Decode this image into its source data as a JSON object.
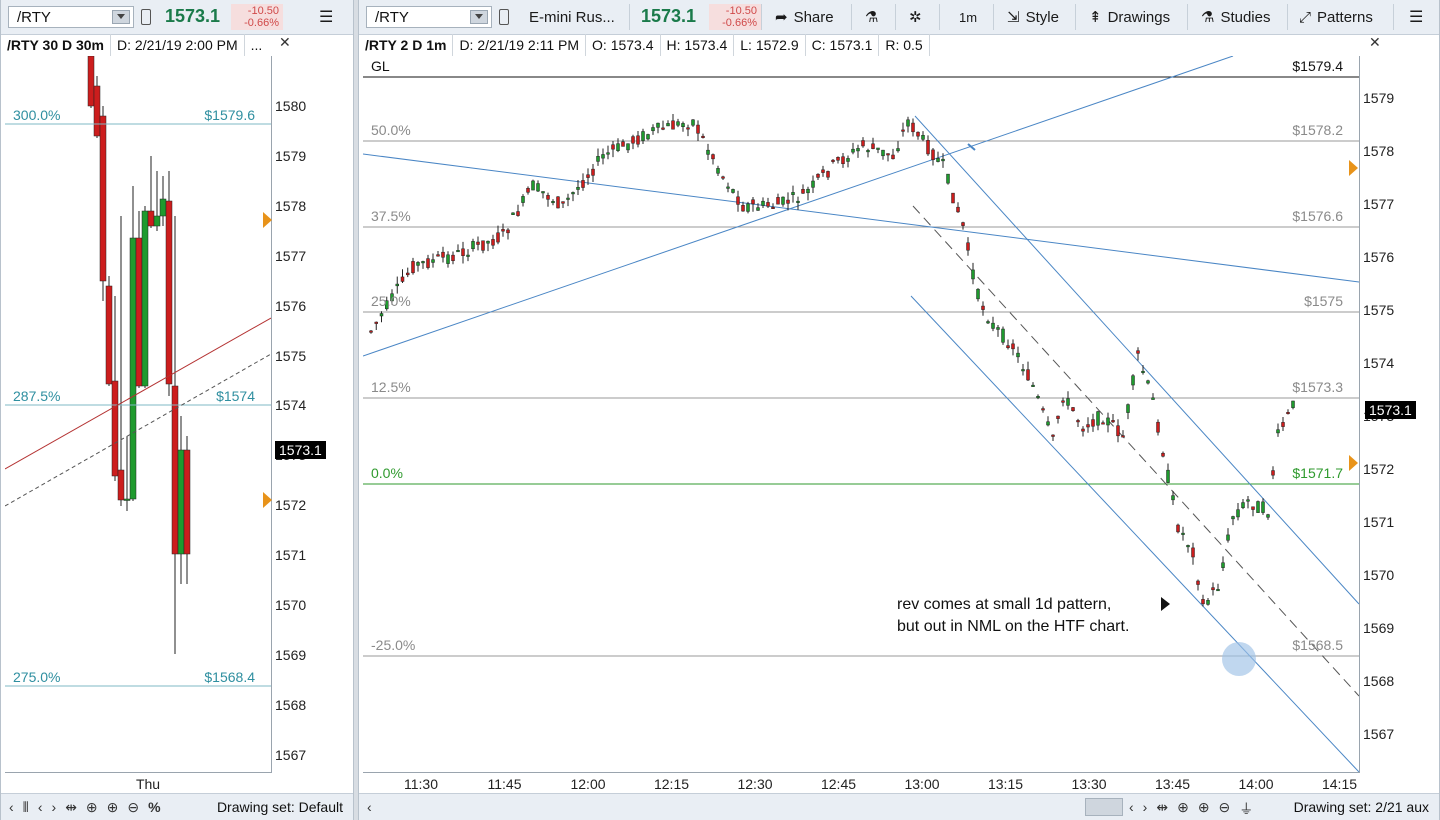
{
  "left": {
    "toolbar": {
      "symbol": "/RTY",
      "last": "1573.1",
      "chg": "-10.50",
      "chg_pct": "-0.66%"
    },
    "info": {
      "title": "/RTY 30 D 30m",
      "date": "D: 2/21/19 2:00 PM",
      "more": "..."
    },
    "y_ticks": [
      "1580",
      "1579",
      "1578",
      "1577",
      "1576",
      "1575",
      "1574",
      "1573",
      "1572",
      "1571",
      "1570",
      "1569",
      "1568",
      "1567"
    ],
    "price_flag": "1573.1",
    "fib": [
      {
        "pct": "300.0%",
        "val": "$1579.6"
      },
      {
        "pct": "287.5%",
        "val": "$1574"
      },
      {
        "pct": "275.0%",
        "val": "$1568.4"
      }
    ],
    "x_label": "Thu",
    "drawing_set": "Drawing set: Default"
  },
  "right": {
    "toolbar": {
      "symbol": "/RTY",
      "name": "E-mini Rus...",
      "last": "1573.1",
      "chg": "-10.50",
      "chg_pct": "-0.66%",
      "share": "Share",
      "timeframe": "1m",
      "style": "Style",
      "drawings": "Drawings",
      "studies": "Studies",
      "patterns": "Patterns"
    },
    "info": {
      "title": "/RTY 2 D 1m",
      "date": "D: 2/21/19 2:11 PM",
      "open": "O: 1573.4",
      "high": "H: 1573.4",
      "low": "L: 1572.9",
      "close": "C: 1573.1",
      "range": "R: 0.5"
    },
    "gl_label": "GL",
    "gl_value": "$1579.4",
    "fib": [
      {
        "pct": "50.0%",
        "val": "$1578.2"
      },
      {
        "pct": "37.5%",
        "val": "$1576.6"
      },
      {
        "pct": "25.0%",
        "val": "$1575"
      },
      {
        "pct": "12.5%",
        "val": "$1573.3"
      },
      {
        "pct": "0.0%",
        "val": "$1571.7"
      },
      {
        "pct": "-25.0%",
        "val": "$1568.5"
      }
    ],
    "y_ticks": [
      "1579",
      "1578",
      "1577",
      "1576",
      "1575",
      "1574",
      "1573",
      "1572",
      "1571",
      "1570",
      "1569",
      "1568",
      "1567"
    ],
    "price_flag": "1573.1",
    "x_ticks": [
      "11:30",
      "11:45",
      "12:00",
      "12:15",
      "12:30",
      "12:45",
      "13:00",
      "13:15",
      "13:30",
      "13:45",
      "14:00",
      "14:15"
    ],
    "annotation_line1": "rev comes at small 1d pattern,",
    "annotation_line2": "but out in NML on the HTF chart.",
    "drawing_set": "Drawing set: 2/21 aux"
  },
  "colors": {
    "up": "#1f9a2e",
    "down": "#cc1d1d",
    "trend": "#4a86c5",
    "fib_zero": "#2f9a2e",
    "accent": "#e8931a"
  },
  "icons": [
    "menu-icon",
    "share-icon",
    "flask-icon",
    "gear-icon",
    "style-icon",
    "drawings-icon",
    "studies-icon",
    "patterns-icon",
    "list-icon",
    "close-x-icon",
    "pan-icon",
    "crosshair-icon",
    "zoom-in-icon",
    "zoom-out-icon",
    "percent-icon",
    "scroll-left-icon",
    "scroll-right-icon"
  ]
}
